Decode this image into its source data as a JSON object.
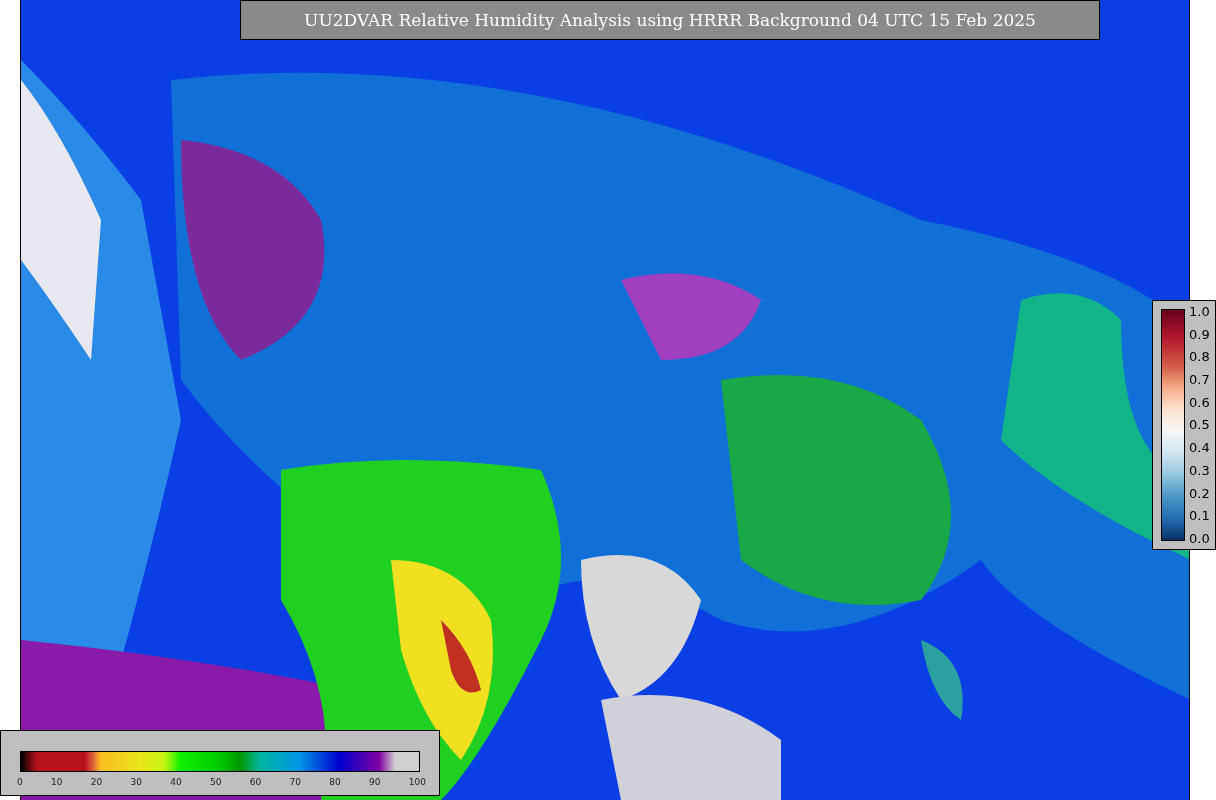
{
  "title": "UU2DVAR Relative Humidity Analysis using HRRR Background 04 UTC 15 Feb 2025",
  "observation_scale": {
    "ticks": [
      "1.0",
      "0.9",
      "0.8",
      "0.7",
      "0.6",
      "0.5",
      "0.4",
      "0.3",
      "0.2",
      "0.1",
      "0.0"
    ]
  },
  "humidity_scale": {
    "ticks": [
      "0",
      "10",
      "20",
      "30",
      "40",
      "50",
      "60",
      "70",
      "80",
      "90",
      "100"
    ]
  }
}
